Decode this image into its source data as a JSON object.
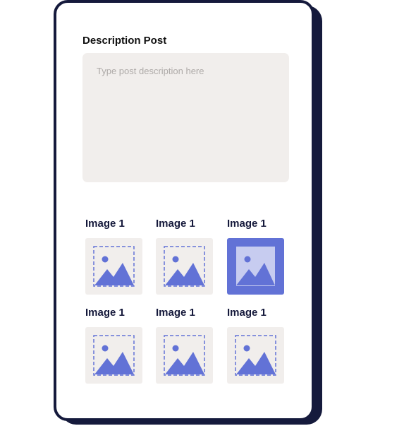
{
  "description": {
    "label": "Description Post",
    "placeholder": "Type post description here"
  },
  "images": [
    {
      "label": "Image 1",
      "selected": false
    },
    {
      "label": "Image 1",
      "selected": false
    },
    {
      "label": "Image 1",
      "selected": true
    },
    {
      "label": "Image 1",
      "selected": false
    },
    {
      "label": "Image 1",
      "selected": false
    },
    {
      "label": "Image 1",
      "selected": false
    }
  ],
  "colors": {
    "accent": "#6272d6",
    "tile_background": "#f1eeec",
    "card_border": "#151a3c"
  },
  "icons": {
    "image_placeholder": "image-placeholder-icon"
  }
}
